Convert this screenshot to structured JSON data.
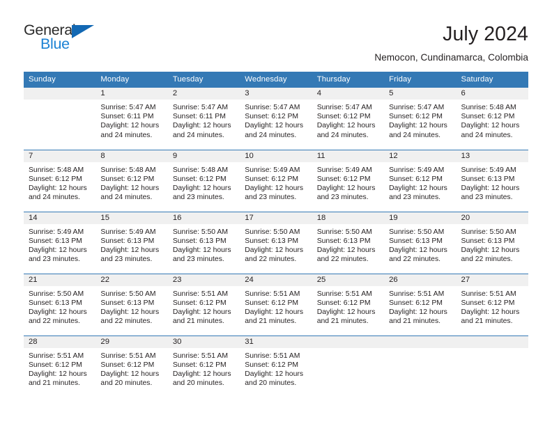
{
  "brand": {
    "name_part1": "General",
    "name_part2": "Blue",
    "triangle_color": "#1268b3",
    "blue_color": "#1c82d4"
  },
  "header": {
    "month_title": "July 2024",
    "location": "Nemocon, Cundinamarca, Colombia",
    "header_bg_color": "#3479b5",
    "daynum_band_color": "#f0f0f0"
  },
  "weekday_headers": [
    "Sunday",
    "Monday",
    "Tuesday",
    "Wednesday",
    "Thursday",
    "Friday",
    "Saturday"
  ],
  "calendar": {
    "weeks": [
      [
        {
          "day": "",
          "empty": true,
          "sunrise": "",
          "sunset": "",
          "daylight1": "",
          "daylight2": ""
        },
        {
          "day": "1",
          "sunrise": "Sunrise: 5:47 AM",
          "sunset": "Sunset: 6:11 PM",
          "daylight1": "Daylight: 12 hours",
          "daylight2": "and 24 minutes."
        },
        {
          "day": "2",
          "sunrise": "Sunrise: 5:47 AM",
          "sunset": "Sunset: 6:11 PM",
          "daylight1": "Daylight: 12 hours",
          "daylight2": "and 24 minutes."
        },
        {
          "day": "3",
          "sunrise": "Sunrise: 5:47 AM",
          "sunset": "Sunset: 6:12 PM",
          "daylight1": "Daylight: 12 hours",
          "daylight2": "and 24 minutes."
        },
        {
          "day": "4",
          "sunrise": "Sunrise: 5:47 AM",
          "sunset": "Sunset: 6:12 PM",
          "daylight1": "Daylight: 12 hours",
          "daylight2": "and 24 minutes."
        },
        {
          "day": "5",
          "sunrise": "Sunrise: 5:47 AM",
          "sunset": "Sunset: 6:12 PM",
          "daylight1": "Daylight: 12 hours",
          "daylight2": "and 24 minutes."
        },
        {
          "day": "6",
          "sunrise": "Sunrise: 5:48 AM",
          "sunset": "Sunset: 6:12 PM",
          "daylight1": "Daylight: 12 hours",
          "daylight2": "and 24 minutes."
        }
      ],
      [
        {
          "day": "7",
          "sunrise": "Sunrise: 5:48 AM",
          "sunset": "Sunset: 6:12 PM",
          "daylight1": "Daylight: 12 hours",
          "daylight2": "and 24 minutes."
        },
        {
          "day": "8",
          "sunrise": "Sunrise: 5:48 AM",
          "sunset": "Sunset: 6:12 PM",
          "daylight1": "Daylight: 12 hours",
          "daylight2": "and 24 minutes."
        },
        {
          "day": "9",
          "sunrise": "Sunrise: 5:48 AM",
          "sunset": "Sunset: 6:12 PM",
          "daylight1": "Daylight: 12 hours",
          "daylight2": "and 23 minutes."
        },
        {
          "day": "10",
          "sunrise": "Sunrise: 5:49 AM",
          "sunset": "Sunset: 6:12 PM",
          "daylight1": "Daylight: 12 hours",
          "daylight2": "and 23 minutes."
        },
        {
          "day": "11",
          "sunrise": "Sunrise: 5:49 AM",
          "sunset": "Sunset: 6:12 PM",
          "daylight1": "Daylight: 12 hours",
          "daylight2": "and 23 minutes."
        },
        {
          "day": "12",
          "sunrise": "Sunrise: 5:49 AM",
          "sunset": "Sunset: 6:12 PM",
          "daylight1": "Daylight: 12 hours",
          "daylight2": "and 23 minutes."
        },
        {
          "day": "13",
          "sunrise": "Sunrise: 5:49 AM",
          "sunset": "Sunset: 6:13 PM",
          "daylight1": "Daylight: 12 hours",
          "daylight2": "and 23 minutes."
        }
      ],
      [
        {
          "day": "14",
          "sunrise": "Sunrise: 5:49 AM",
          "sunset": "Sunset: 6:13 PM",
          "daylight1": "Daylight: 12 hours",
          "daylight2": "and 23 minutes."
        },
        {
          "day": "15",
          "sunrise": "Sunrise: 5:49 AM",
          "sunset": "Sunset: 6:13 PM",
          "daylight1": "Daylight: 12 hours",
          "daylight2": "and 23 minutes."
        },
        {
          "day": "16",
          "sunrise": "Sunrise: 5:50 AM",
          "sunset": "Sunset: 6:13 PM",
          "daylight1": "Daylight: 12 hours",
          "daylight2": "and 23 minutes."
        },
        {
          "day": "17",
          "sunrise": "Sunrise: 5:50 AM",
          "sunset": "Sunset: 6:13 PM",
          "daylight1": "Daylight: 12 hours",
          "daylight2": "and 22 minutes."
        },
        {
          "day": "18",
          "sunrise": "Sunrise: 5:50 AM",
          "sunset": "Sunset: 6:13 PM",
          "daylight1": "Daylight: 12 hours",
          "daylight2": "and 22 minutes."
        },
        {
          "day": "19",
          "sunrise": "Sunrise: 5:50 AM",
          "sunset": "Sunset: 6:13 PM",
          "daylight1": "Daylight: 12 hours",
          "daylight2": "and 22 minutes."
        },
        {
          "day": "20",
          "sunrise": "Sunrise: 5:50 AM",
          "sunset": "Sunset: 6:13 PM",
          "daylight1": "Daylight: 12 hours",
          "daylight2": "and 22 minutes."
        }
      ],
      [
        {
          "day": "21",
          "sunrise": "Sunrise: 5:50 AM",
          "sunset": "Sunset: 6:13 PM",
          "daylight1": "Daylight: 12 hours",
          "daylight2": "and 22 minutes."
        },
        {
          "day": "22",
          "sunrise": "Sunrise: 5:50 AM",
          "sunset": "Sunset: 6:13 PM",
          "daylight1": "Daylight: 12 hours",
          "daylight2": "and 22 minutes."
        },
        {
          "day": "23",
          "sunrise": "Sunrise: 5:51 AM",
          "sunset": "Sunset: 6:12 PM",
          "daylight1": "Daylight: 12 hours",
          "daylight2": "and 21 minutes."
        },
        {
          "day": "24",
          "sunrise": "Sunrise: 5:51 AM",
          "sunset": "Sunset: 6:12 PM",
          "daylight1": "Daylight: 12 hours",
          "daylight2": "and 21 minutes."
        },
        {
          "day": "25",
          "sunrise": "Sunrise: 5:51 AM",
          "sunset": "Sunset: 6:12 PM",
          "daylight1": "Daylight: 12 hours",
          "daylight2": "and 21 minutes."
        },
        {
          "day": "26",
          "sunrise": "Sunrise: 5:51 AM",
          "sunset": "Sunset: 6:12 PM",
          "daylight1": "Daylight: 12 hours",
          "daylight2": "and 21 minutes."
        },
        {
          "day": "27",
          "sunrise": "Sunrise: 5:51 AM",
          "sunset": "Sunset: 6:12 PM",
          "daylight1": "Daylight: 12 hours",
          "daylight2": "and 21 minutes."
        }
      ],
      [
        {
          "day": "28",
          "sunrise": "Sunrise: 5:51 AM",
          "sunset": "Sunset: 6:12 PM",
          "daylight1": "Daylight: 12 hours",
          "daylight2": "and 21 minutes."
        },
        {
          "day": "29",
          "sunrise": "Sunrise: 5:51 AM",
          "sunset": "Sunset: 6:12 PM",
          "daylight1": "Daylight: 12 hours",
          "daylight2": "and 20 minutes."
        },
        {
          "day": "30",
          "sunrise": "Sunrise: 5:51 AM",
          "sunset": "Sunset: 6:12 PM",
          "daylight1": "Daylight: 12 hours",
          "daylight2": "and 20 minutes."
        },
        {
          "day": "31",
          "sunrise": "Sunrise: 5:51 AM",
          "sunset": "Sunset: 6:12 PM",
          "daylight1": "Daylight: 12 hours",
          "daylight2": "and 20 minutes."
        },
        {
          "day": "",
          "empty": true,
          "sunrise": "",
          "sunset": "",
          "daylight1": "",
          "daylight2": ""
        },
        {
          "day": "",
          "empty": true,
          "sunrise": "",
          "sunset": "",
          "daylight1": "",
          "daylight2": ""
        },
        {
          "day": "",
          "empty": true,
          "sunrise": "",
          "sunset": "",
          "daylight1": "",
          "daylight2": ""
        }
      ]
    ]
  }
}
